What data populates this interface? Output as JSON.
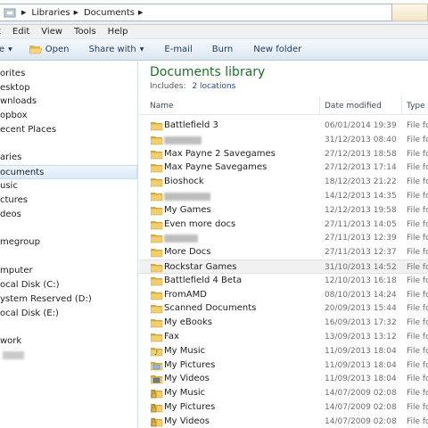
{
  "address": {
    "crumbs": [
      "Libraries",
      "Documents"
    ]
  },
  "menu": {
    "items": [
      "t",
      "Edit",
      "View",
      "Tools",
      "Help"
    ]
  },
  "toolbar": {
    "organize_label": "e",
    "open_label": "Open",
    "share_label": "Share with",
    "email_label": "E-mail",
    "burn_label": "Burn",
    "newfolder_label": "New folder"
  },
  "nav": {
    "items": [
      {
        "label": "orites"
      },
      {
        "label": "esktop"
      },
      {
        "label": "wnloads"
      },
      {
        "label": "opbox"
      },
      {
        "label": "ecent Places"
      },
      {
        "label": "aries"
      },
      {
        "label": "ocuments"
      },
      {
        "label": "usic"
      },
      {
        "label": "ctures"
      },
      {
        "label": "deos"
      },
      {
        "label": "megroup"
      },
      {
        "label": "mputer"
      },
      {
        "label": "ocal Disk (C:)"
      },
      {
        "label": "ystem Reserved (D:)"
      },
      {
        "label": "ocal Disk (E:)"
      },
      {
        "label": "work"
      }
    ]
  },
  "library": {
    "title": "Documents library",
    "includes_label": "Includes:",
    "locations_link": "2 locations"
  },
  "columns": {
    "name": "Name",
    "date": "Date modified",
    "type": "Type"
  },
  "files": [
    {
      "name": "Battlefield 3",
      "date": "06/01/2014 19:39",
      "type": "File fo",
      "icon": "folder-icon"
    },
    {
      "name": "",
      "date": "31/12/2013 08:40",
      "type": "File fo",
      "icon": "folder-icon"
    },
    {
      "name": "Max Payne 2 Savegames",
      "date": "27/12/2013 18:58",
      "type": "File fo",
      "icon": "folder-icon"
    },
    {
      "name": "Max Payne Savegames",
      "date": "27/12/2013 17:14",
      "type": "File fo",
      "icon": "folder-icon"
    },
    {
      "name": "Bioshock",
      "date": "18/12/2013 21:22",
      "type": "File fo",
      "icon": "folder-icon"
    },
    {
      "name": "",
      "date": "14/12/2013 14:35",
      "type": "File fo",
      "icon": "folder-icon"
    },
    {
      "name": "My Games",
      "date": "12/12/2013 19:58",
      "type": "File fo",
      "icon": "folder-icon"
    },
    {
      "name": "Even more docs",
      "date": "27/11/2013 14:05",
      "type": "File fo",
      "icon": "folder-icon"
    },
    {
      "name": "",
      "date": "27/11/2013 12:39",
      "type": "File fo",
      "icon": "folder-icon"
    },
    {
      "name": "More Docs",
      "date": "27/11/2013 12:37",
      "type": "File fo",
      "icon": "folder-icon"
    },
    {
      "name": "Rockstar Games",
      "date": "31/10/2013 14:52",
      "type": "File fo",
      "icon": "folder-icon"
    },
    {
      "name": "Battlefield 4 Beta",
      "date": "12/10/2013 16:18",
      "type": "File fo",
      "icon": "folder-icon"
    },
    {
      "name": "FromAMD",
      "date": "08/10/2013 14:24",
      "type": "File fo",
      "icon": "folder-icon"
    },
    {
      "name": "Scanned Documents",
      "date": "20/09/2013 15:44",
      "type": "File fo",
      "icon": "folder-icon"
    },
    {
      "name": "My eBooks",
      "date": "16/09/2013 17:32",
      "type": "File fo",
      "icon": "folder-icon"
    },
    {
      "name": "Fax",
      "date": "13/09/2013 13:12",
      "type": "File fo",
      "icon": "folder-icon"
    },
    {
      "name": "My Music",
      "date": "11/09/2013 18:04",
      "type": "File fo",
      "icon": "music-folder-icon"
    },
    {
      "name": "My Pictures",
      "date": "11/09/2013 18:04",
      "type": "File fo",
      "icon": "pictures-folder-icon"
    },
    {
      "name": "My Videos",
      "date": "11/09/2013 18:04",
      "type": "File fo",
      "icon": "videos-folder-icon"
    },
    {
      "name": "My Music",
      "date": "14/07/2009 02:08",
      "type": "File fo",
      "icon": "locked-folder-icon"
    },
    {
      "name": "My Pictures",
      "date": "14/07/2009 02:08",
      "type": "File fo",
      "icon": "locked-folder-icon"
    },
    {
      "name": "My Videos",
      "date": "14/07/2009 02:08",
      "type": "File fo",
      "icon": "locked-folder-icon"
    }
  ],
  "colors": {
    "library_title": "#1e6e2e",
    "link": "#1a4fa0",
    "folder": "#e8c35a"
  }
}
